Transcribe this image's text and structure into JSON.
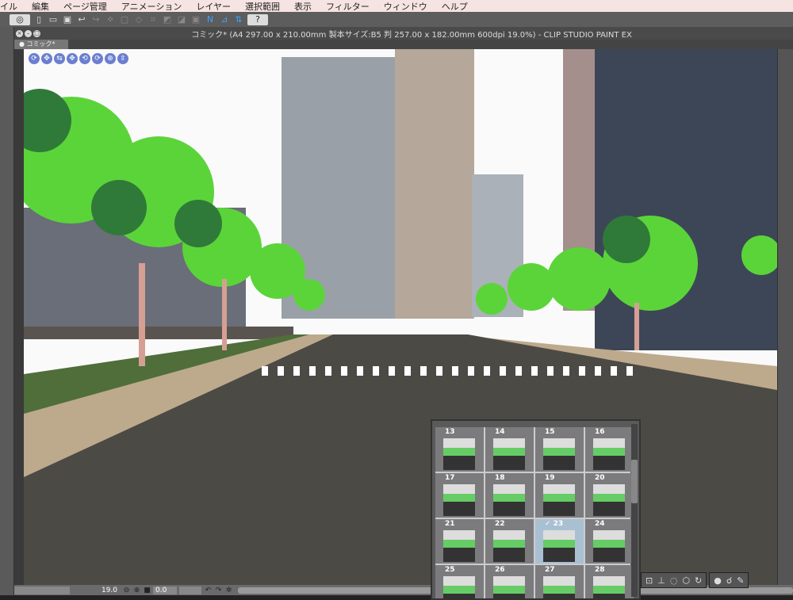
{
  "menu": [
    "イル",
    "編集",
    "ページ管理",
    "アニメーション",
    "レイヤー",
    "選択範囲",
    "表示",
    "フィルター",
    "ウィンドウ",
    "ヘルプ"
  ],
  "title": "コミック* (A4 297.00 x 210.00mm 製本サイズ:B5 判 257.00 x 182.00mm 600dpi 19.0%)  - CLIP STUDIO PAINT EX",
  "doc_tab": "● コミック*",
  "status": {
    "zoom": "19.0",
    "angle": "0.0"
  },
  "thumbnails": [
    {
      "num": "13"
    },
    {
      "num": "14"
    },
    {
      "num": "15"
    },
    {
      "num": "16"
    },
    {
      "num": "17"
    },
    {
      "num": "18"
    },
    {
      "num": "19"
    },
    {
      "num": "20"
    },
    {
      "num": "21"
    },
    {
      "num": "22"
    },
    {
      "num": "✓ 23",
      "selected": true
    },
    {
      "num": "24"
    },
    {
      "num": "25"
    },
    {
      "num": "26"
    },
    {
      "num": "27"
    },
    {
      "num": "28"
    }
  ]
}
